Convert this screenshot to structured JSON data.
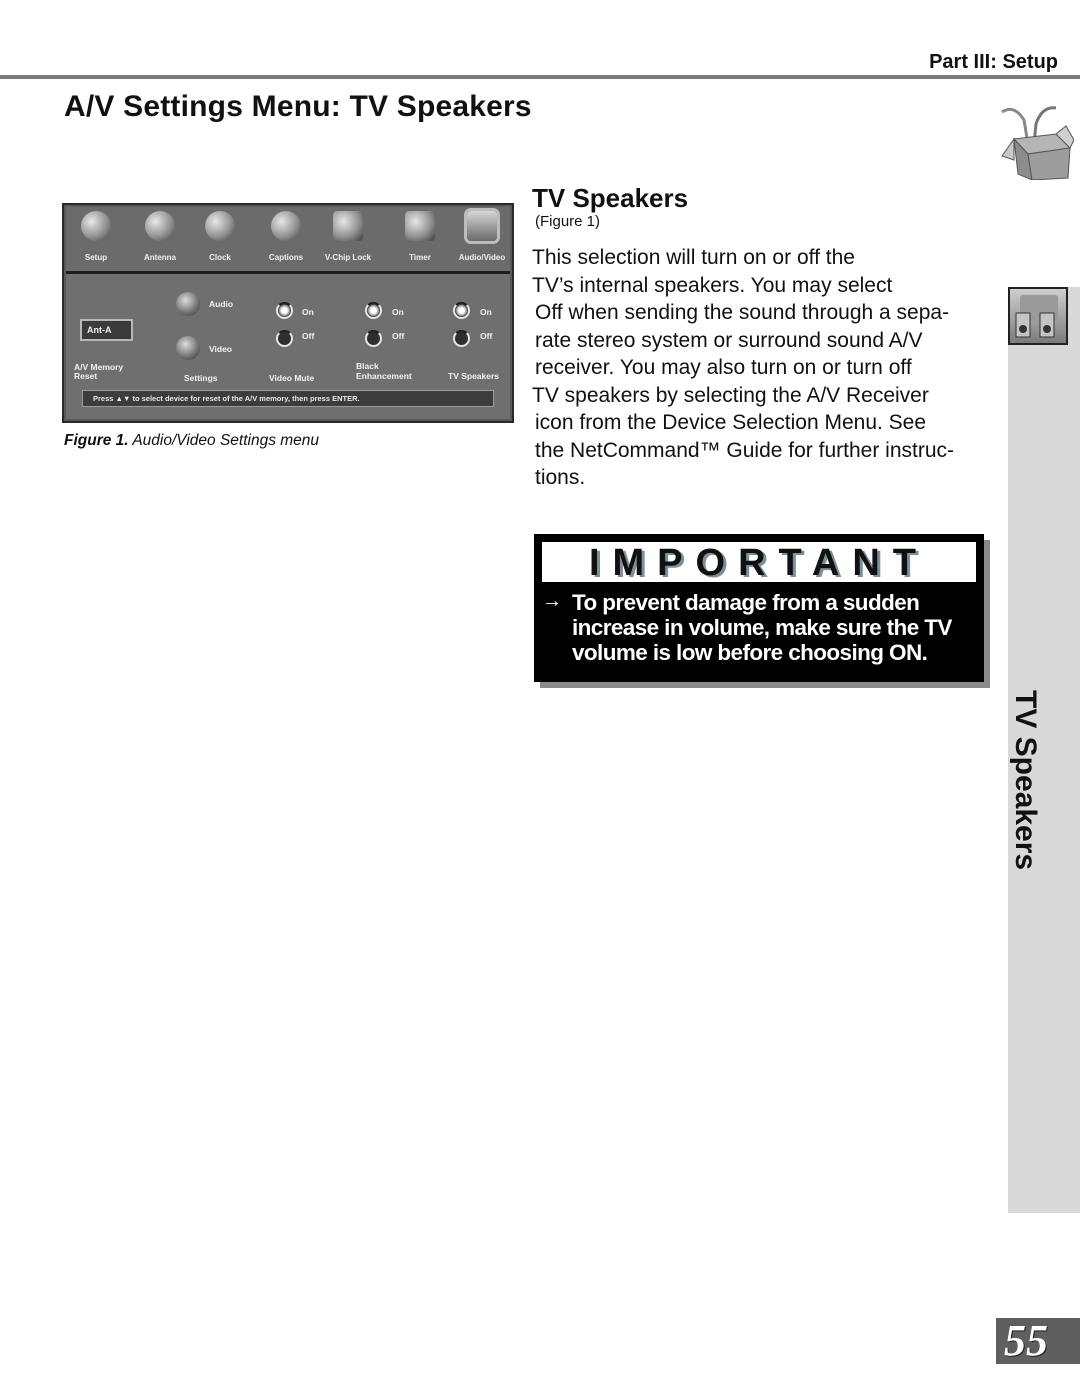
{
  "header": {
    "part_label": "Part III: Setup",
    "page_title": "A/V Settings Menu: TV Speakers"
  },
  "figure": {
    "menu_nav": [
      {
        "label": "Setup",
        "icon": "plug-icon"
      },
      {
        "label": "Antenna",
        "icon": "antenna-icon"
      },
      {
        "label": "Clock",
        "icon": "clock-icon"
      },
      {
        "label": "Captions",
        "icon": "captions-icon"
      },
      {
        "label": "V-Chip Lock",
        "icon": "padlock-icon"
      },
      {
        "label": "Timer",
        "icon": "timer-icon"
      },
      {
        "label": "Audio/Video",
        "icon": "speakers-icon",
        "active": true
      }
    ],
    "memory_device": "Ant-A",
    "memory_label_line1": "A/V Memory",
    "memory_label_line2": "Reset",
    "settings_audio": "Audio",
    "settings_video": "Video",
    "settings_label": "Settings",
    "on_label": "On",
    "off_label": "Off",
    "video_mute_label": "Video Mute",
    "black_enh_line1": "Black",
    "black_enh_line2": "Enhancement",
    "tv_speakers_label": "TV Speakers",
    "status_message": "Press ▲▼ to select device for reset of the A/V memory, then press ENTER.",
    "caption_bold": "Figure 1.",
    "caption_text": " Audio/Video Settings menu"
  },
  "section": {
    "title": "TV Speakers",
    "figure_ref": "(Figure 1)",
    "body_lines": [
      "This selection will turn on or off the",
      "TV’s internal speakers.  You may select",
      "Off when sending the sound through a sepa-",
      "rate stereo system or surround sound A/V",
      "receiver.  You may also turn on or turn off",
      "TV speakers by selecting the A/V Receiver",
      "icon from the Device Selection Menu.  See",
      "the NetCommand™ Guide for further instruc-",
      "tions."
    ]
  },
  "important": {
    "banner": "IMPORTANT",
    "arrow": "→",
    "message": "To prevent damage from a sudden increase in volume, make sure the TV volume is low before choosing ON."
  },
  "side_tab": {
    "label": "TV Speakers",
    "icon": "speakers-icon"
  },
  "page_number": "55"
}
